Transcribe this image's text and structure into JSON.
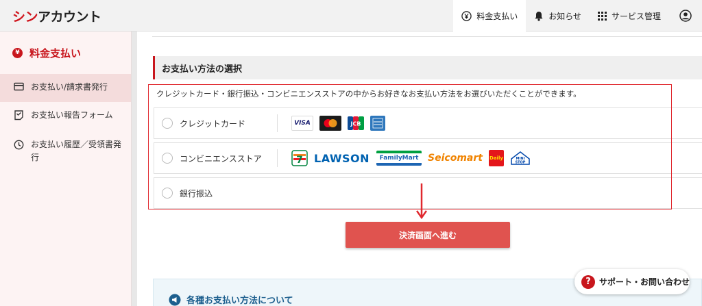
{
  "app": {
    "logo_accent": "シン",
    "logo_rest": "アカウント"
  },
  "topnav": {
    "billing": "料金支払い",
    "notices": "お知らせ",
    "services": "サービス管理"
  },
  "sidebar": {
    "title": "料金支払い",
    "items": [
      {
        "label": "お支払い/請求書発行",
        "active": true
      },
      {
        "label": "お支払い報告フォーム",
        "active": false
      },
      {
        "label": "お支払い履歴／受領書発行",
        "active": false
      }
    ]
  },
  "main": {
    "section_title": "お支払い方法の選択",
    "intro": "クレジットカード・銀行振込・コンビニエンスストアの中からお好きなお支払い方法をお選びいただくことができます。",
    "options": [
      {
        "label": "クレジットカード",
        "logos": [
          "VISA",
          "Mastercard",
          "JCB",
          "AMEX"
        ]
      },
      {
        "label": "コンビニエンスストア",
        "logos": [
          "7",
          "LAWSON",
          "FamilyMart",
          "Seicomart",
          "Daily",
          "MINI STOP"
        ]
      },
      {
        "label": "銀行振込",
        "logos": []
      }
    ],
    "submit_label": "決済画面へ進む",
    "info_title": "各種お支払い方法について"
  },
  "support": {
    "label": "サポート・お問い合わせ"
  },
  "colors": {
    "brand_red": "#c8161d",
    "button_red": "#e0534f",
    "annotation_red": "#e0282e",
    "info_blue": "#1d5f8e"
  }
}
